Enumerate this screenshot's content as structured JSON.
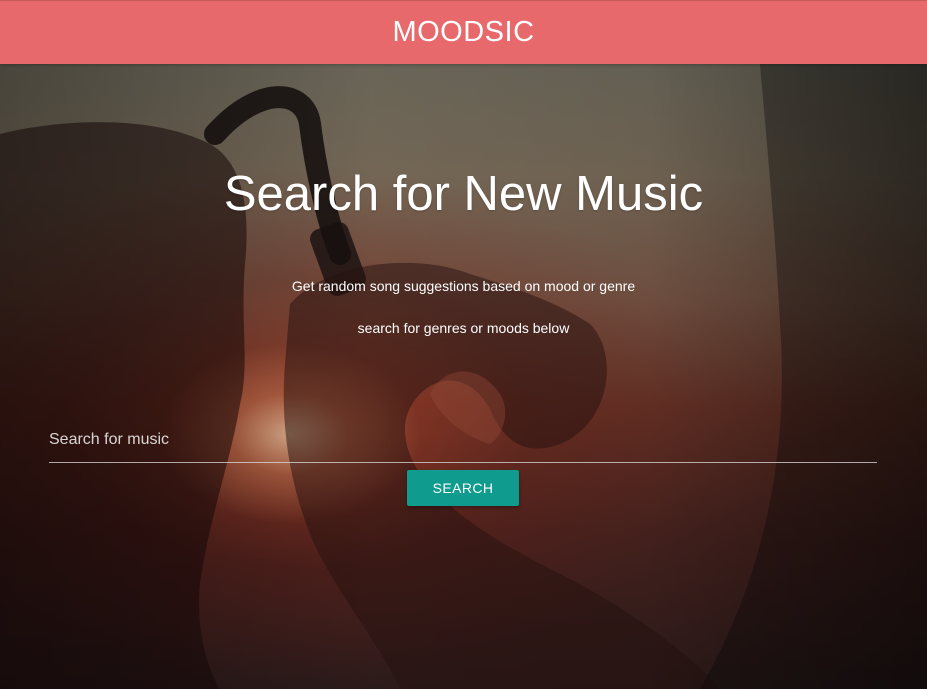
{
  "navbar": {
    "brand": "MOODSIC",
    "background_color": "#e8696b"
  },
  "hero": {
    "title": "Search for New Music",
    "subtitle_line1": "Get random song suggestions based on mood or genre",
    "subtitle_line2": "search for genres or moods below",
    "background_image": "silhouette of person wearing headphones forming a heart with hands at sunset"
  },
  "search": {
    "placeholder": "Search for music",
    "value": "",
    "button_label": "SEARCH",
    "button_color": "#0f9c8e"
  }
}
